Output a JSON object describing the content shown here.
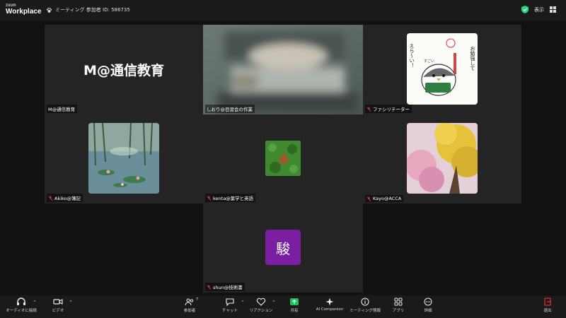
{
  "app": {
    "logo_top": "zoom",
    "logo_bottom": "Workplace"
  },
  "header": {
    "meeting_info": "ミーティング 参加者 ID: 586735",
    "view_label": "表示"
  },
  "tiles": {
    "m_tsushin": {
      "name": "M@通信教育",
      "big_text": "M@通信教育"
    },
    "shiori": {
      "name": "しおり@目習会の作業"
    },
    "facilitator": {
      "name": "ファシリテーター"
    },
    "akiko": {
      "name": "Akiko@簿記"
    },
    "kenta": {
      "name": "kenta@薬学と英語"
    },
    "kayo": {
      "name": "Kayo@ACCA"
    },
    "shun": {
      "name": "shun@技術書",
      "avatar_char": "駿",
      "avatar_color": "#7b1fa2"
    }
  },
  "sticker_text": {
    "left": "えら〜い！",
    "right": "お勉強して",
    "bubble": "すごい"
  },
  "toolbar": {
    "audio": "オーディオに接続",
    "video": "ビデオ",
    "participants": "参加者",
    "participants_count": "7",
    "chat": "チャット",
    "reactions": "リアクション",
    "share": "共有",
    "ai": "AI Companion",
    "info": "ミーティング情報",
    "apps": "アプリ",
    "more": "詳細",
    "leave": "退出"
  },
  "colors": {
    "speaking_border": "#4ce08a",
    "share_green": "#1fbf5a",
    "leave_red": "#e02b2b"
  }
}
